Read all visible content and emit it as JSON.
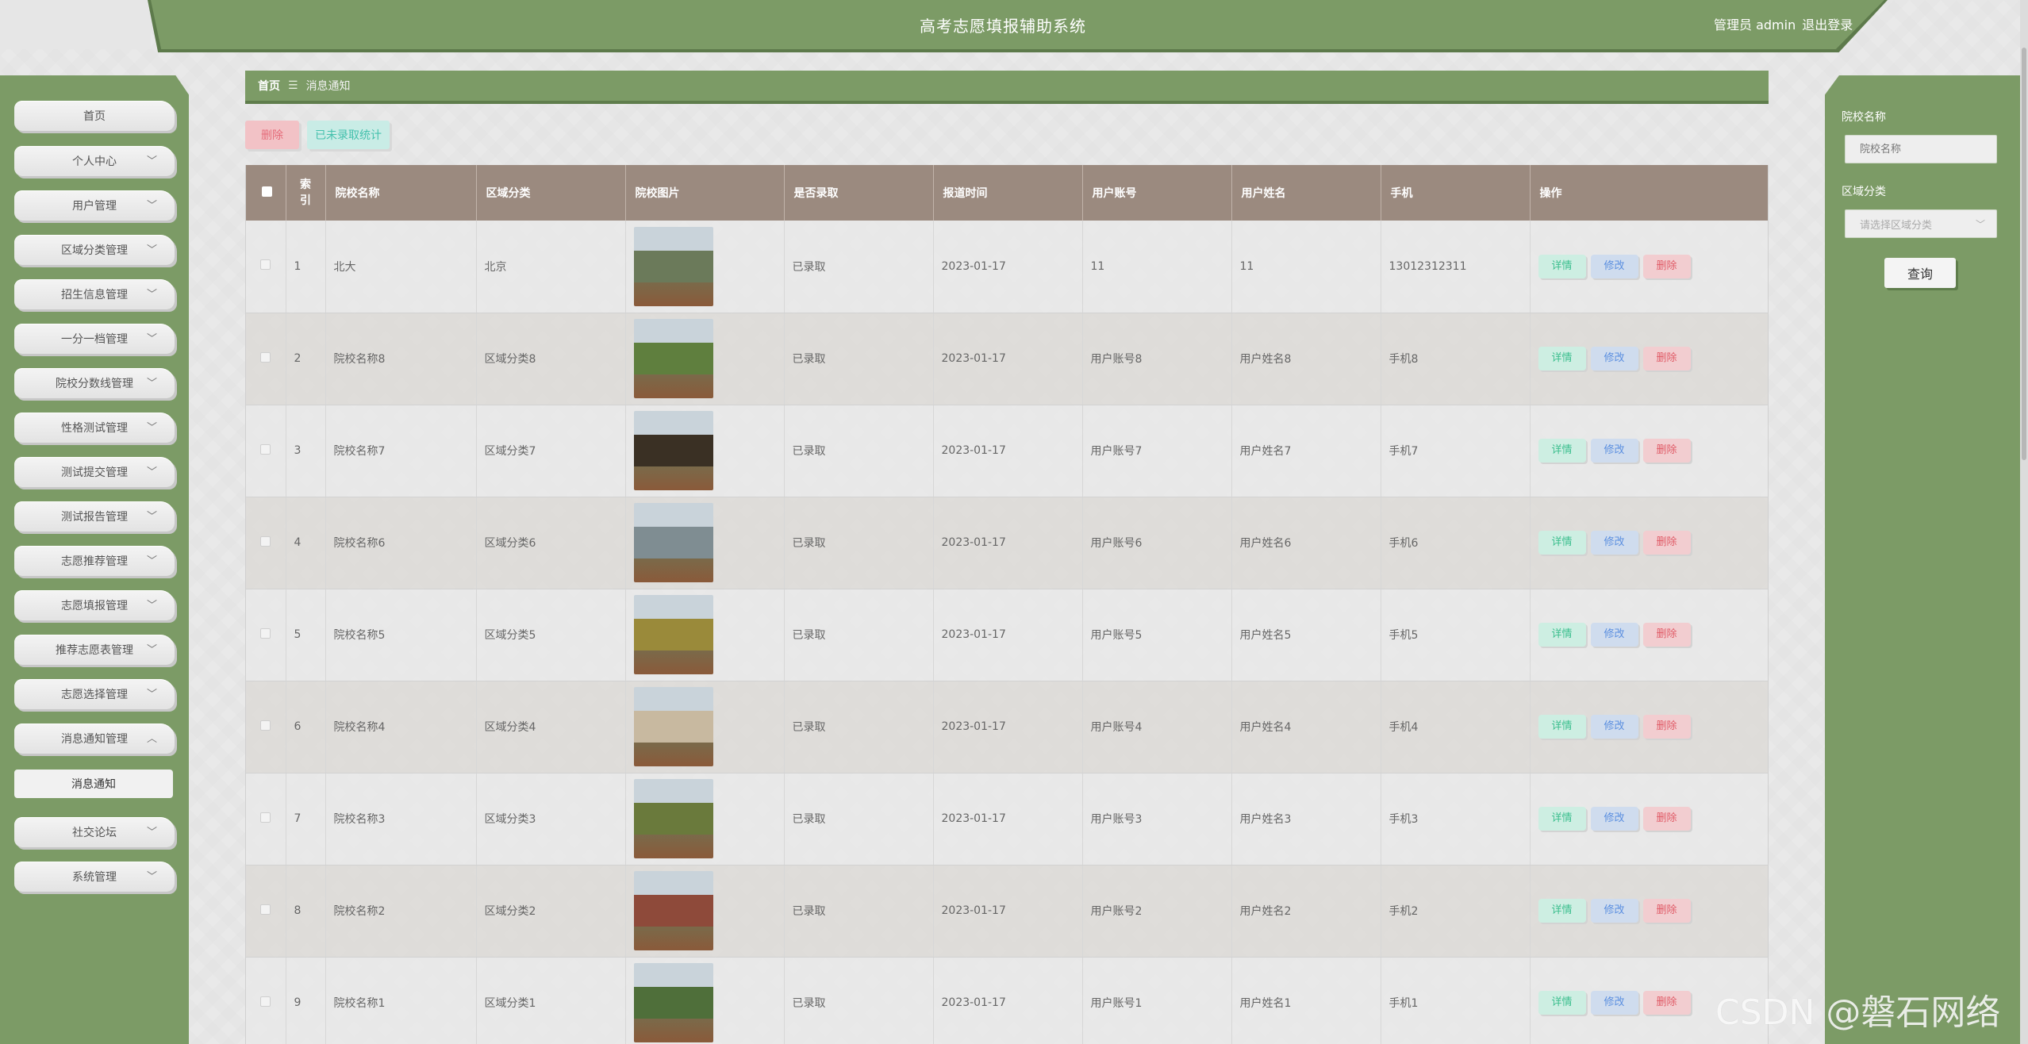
{
  "header": {
    "title": "高考志愿填报辅助系统",
    "user_role": "管理员 admin",
    "logout": "退出登录"
  },
  "sidebar": {
    "items": [
      {
        "label": "首页",
        "expandable": false
      },
      {
        "label": "个人中心",
        "expandable": true
      },
      {
        "label": "用户管理",
        "expandable": true
      },
      {
        "label": "区域分类管理",
        "expandable": true
      },
      {
        "label": "招生信息管理",
        "expandable": true
      },
      {
        "label": "一分一档管理",
        "expandable": true
      },
      {
        "label": "院校分数线管理",
        "expandable": true
      },
      {
        "label": "性格测试管理",
        "expandable": true
      },
      {
        "label": "测试提交管理",
        "expandable": true
      },
      {
        "label": "测试报告管理",
        "expandable": true
      },
      {
        "label": "志愿推荐管理",
        "expandable": true
      },
      {
        "label": "志愿填报管理",
        "expandable": true
      },
      {
        "label": "推荐志愿表管理",
        "expandable": true
      },
      {
        "label": "志愿选择管理",
        "expandable": true
      },
      {
        "label": "消息通知管理",
        "expandable": true,
        "expanded": true
      },
      {
        "label": "消息通知",
        "sub": true
      },
      {
        "label": "社交论坛",
        "expandable": true
      },
      {
        "label": "系统管理",
        "expandable": true
      }
    ]
  },
  "breadcrumb": {
    "home": "首页",
    "separator": "☰",
    "current": "消息通知"
  },
  "toolbar": {
    "delete_label": "删除",
    "stat_label": "已未录取统计"
  },
  "table": {
    "columns": [
      "",
      "索引",
      "院校名称",
      "区域分类",
      "院校图片",
      "是否录取",
      "报道时间",
      "用户账号",
      "用户姓名",
      "手机",
      "操作"
    ],
    "index_header_lines": [
      "索",
      "引"
    ],
    "actions": {
      "detail": "详情",
      "edit": "修改",
      "delete": "删除"
    },
    "rows": [
      {
        "index": "1",
        "school": "北大",
        "region": "北京",
        "admitted": "已录取",
        "date": "2023-01-17",
        "account": "11",
        "name": "11",
        "phone": "13012312311",
        "img_color": "#6b7a5a"
      },
      {
        "index": "2",
        "school": "院校名称8",
        "region": "区域分类8",
        "admitted": "已录取",
        "date": "2023-01-17",
        "account": "用户账号8",
        "name": "用户姓名8",
        "phone": "手机8",
        "img_color": "#5f7f3e"
      },
      {
        "index": "3",
        "school": "院校名称7",
        "region": "区域分类7",
        "admitted": "已录取",
        "date": "2023-01-17",
        "account": "用户账号7",
        "name": "用户姓名7",
        "phone": "手机7",
        "img_color": "#3a3024"
      },
      {
        "index": "4",
        "school": "院校名称6",
        "region": "区域分类6",
        "admitted": "已录取",
        "date": "2023-01-17",
        "account": "用户账号6",
        "name": "用户姓名6",
        "phone": "手机6",
        "img_color": "#7f8d92"
      },
      {
        "index": "5",
        "school": "院校名称5",
        "region": "区域分类5",
        "admitted": "已录取",
        "date": "2023-01-17",
        "account": "用户账号5",
        "name": "用户姓名5",
        "phone": "手机5",
        "img_color": "#9a8a3a"
      },
      {
        "index": "6",
        "school": "院校名称4",
        "region": "区域分类4",
        "admitted": "已录取",
        "date": "2023-01-17",
        "account": "用户账号4",
        "name": "用户姓名4",
        "phone": "手机4",
        "img_color": "#c8b9a0"
      },
      {
        "index": "7",
        "school": "院校名称3",
        "region": "区域分类3",
        "admitted": "已录取",
        "date": "2023-01-17",
        "account": "用户账号3",
        "name": "用户姓名3",
        "phone": "手机3",
        "img_color": "#6a7a3c"
      },
      {
        "index": "8",
        "school": "院校名称2",
        "region": "区域分类2",
        "admitted": "已录取",
        "date": "2023-01-17",
        "account": "用户账号2",
        "name": "用户姓名2",
        "phone": "手机2",
        "img_color": "#8e4a3a"
      },
      {
        "index": "9",
        "school": "院校名称1",
        "region": "区域分类1",
        "admitted": "已录取",
        "date": "2023-01-17",
        "account": "用户账号1",
        "name": "用户姓名1",
        "phone": "手机1",
        "img_color": "#4f6f3a"
      }
    ]
  },
  "search": {
    "school_label": "院校名称",
    "school_placeholder": "院校名称",
    "region_label": "区域分类",
    "region_placeholder": "请选择区域分类",
    "query_label": "查询"
  },
  "watermark": "CSDN @磐石网络",
  "colors": {
    "accent": "#7c9b66",
    "table_header": "#9b8a7f",
    "danger": "#e05b67",
    "success": "#3cbf8e",
    "info": "#5b8fe0"
  }
}
